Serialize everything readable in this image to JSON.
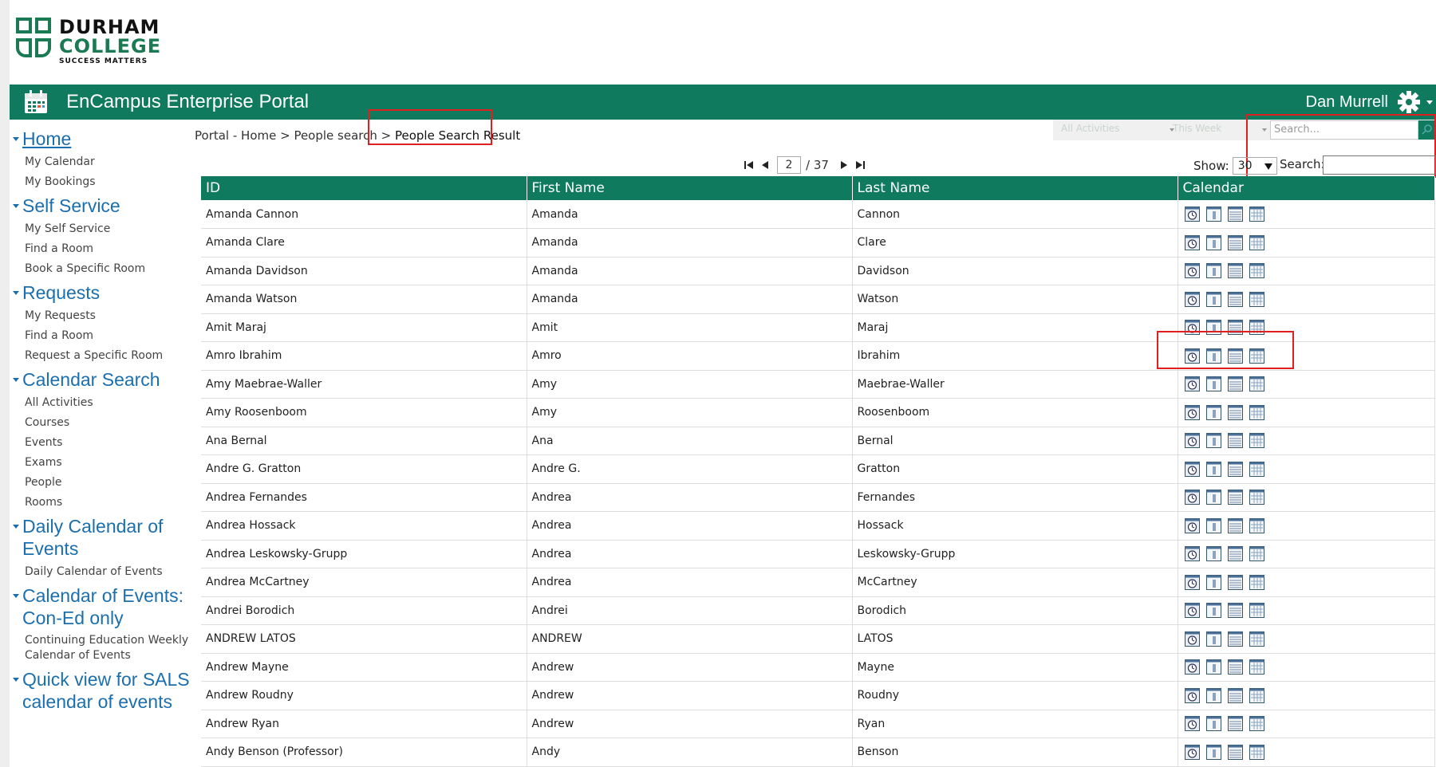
{
  "logo": {
    "line1": "DURHAM",
    "line2": "COLLEGE",
    "tagline": "SUCCESS MATTERS"
  },
  "header": {
    "title": "EnCampus Enterprise Portal",
    "user": "Dan Murrell",
    "brand_color": "#0f7a5d"
  },
  "sidebar": {
    "sections": [
      {
        "title": "Home",
        "items": [
          "My Calendar",
          "My Bookings"
        ]
      },
      {
        "title": "Self Service",
        "items": [
          "My Self Service",
          "Find a Room",
          "Book a Specific Room"
        ]
      },
      {
        "title": "Requests",
        "items": [
          "My Requests",
          "Find a Room",
          "Request a Specific Room"
        ]
      },
      {
        "title": "Calendar Search",
        "items": [
          "All Activities",
          "Courses",
          "Events",
          "Exams",
          "People",
          "Rooms"
        ]
      },
      {
        "title": "Daily Calendar of Events",
        "items": [
          "Daily Calendar of Events"
        ]
      },
      {
        "title": "Calendar of Events: Con-Ed only",
        "items": [
          "Continuing Education Weekly Calendar of Events"
        ]
      },
      {
        "title": "Quick view for SALS calendar of events",
        "items": []
      }
    ]
  },
  "breadcrumb": {
    "path": "Portal - Home > People search > ",
    "current": "People Search Result"
  },
  "filters": {
    "activities": "All Activities",
    "period": "This Week",
    "search_placeholder": "Search..."
  },
  "pager": {
    "current_page": "2",
    "total_pages": "/ 37",
    "show_label": "Show:",
    "show_value": "30",
    "search_label": "Search:"
  },
  "table": {
    "headers": [
      "ID",
      "First Name",
      "Last Name",
      "Calendar"
    ],
    "rows": [
      [
        "Amanda Cannon",
        "Amanda",
        "Cannon"
      ],
      [
        "Amanda Clare",
        "Amanda",
        "Clare"
      ],
      [
        "Amanda Davidson",
        "Amanda",
        "Davidson"
      ],
      [
        "Amanda Watson",
        "Amanda",
        "Watson"
      ],
      [
        "Amit Maraj",
        "Amit",
        "Maraj"
      ],
      [
        "Amro Ibrahim",
        "Amro",
        "Ibrahim"
      ],
      [
        "Amy Maebrae-Waller",
        "Amy",
        "Maebrae-Waller"
      ],
      [
        "Amy Roosenboom",
        "Amy",
        "Roosenboom"
      ],
      [
        "Ana Bernal",
        "Ana",
        "Bernal"
      ],
      [
        "Andre G. Gratton",
        "Andre G.",
        "Gratton"
      ],
      [
        "Andrea Fernandes",
        "Andrea",
        "Fernandes"
      ],
      [
        "Andrea Hossack",
        "Andrea",
        "Hossack"
      ],
      [
        "Andrea Leskowsky-Grupp",
        "Andrea",
        "Leskowsky-Grupp"
      ],
      [
        "Andrea McCartney",
        "Andrea",
        "McCartney"
      ],
      [
        "Andrei Borodich",
        "Andrei",
        "Borodich"
      ],
      [
        "ANDREW LATOS",
        "ANDREW",
        "LATOS"
      ],
      [
        "Andrew Mayne",
        "Andrew",
        "Mayne"
      ],
      [
        "Andrew Roudny",
        "Andrew",
        "Roudny"
      ],
      [
        "Andrew Ryan",
        "Andrew",
        "Ryan"
      ],
      [
        "Andy Benson (Professor)",
        "Andy",
        "Benson"
      ]
    ]
  }
}
